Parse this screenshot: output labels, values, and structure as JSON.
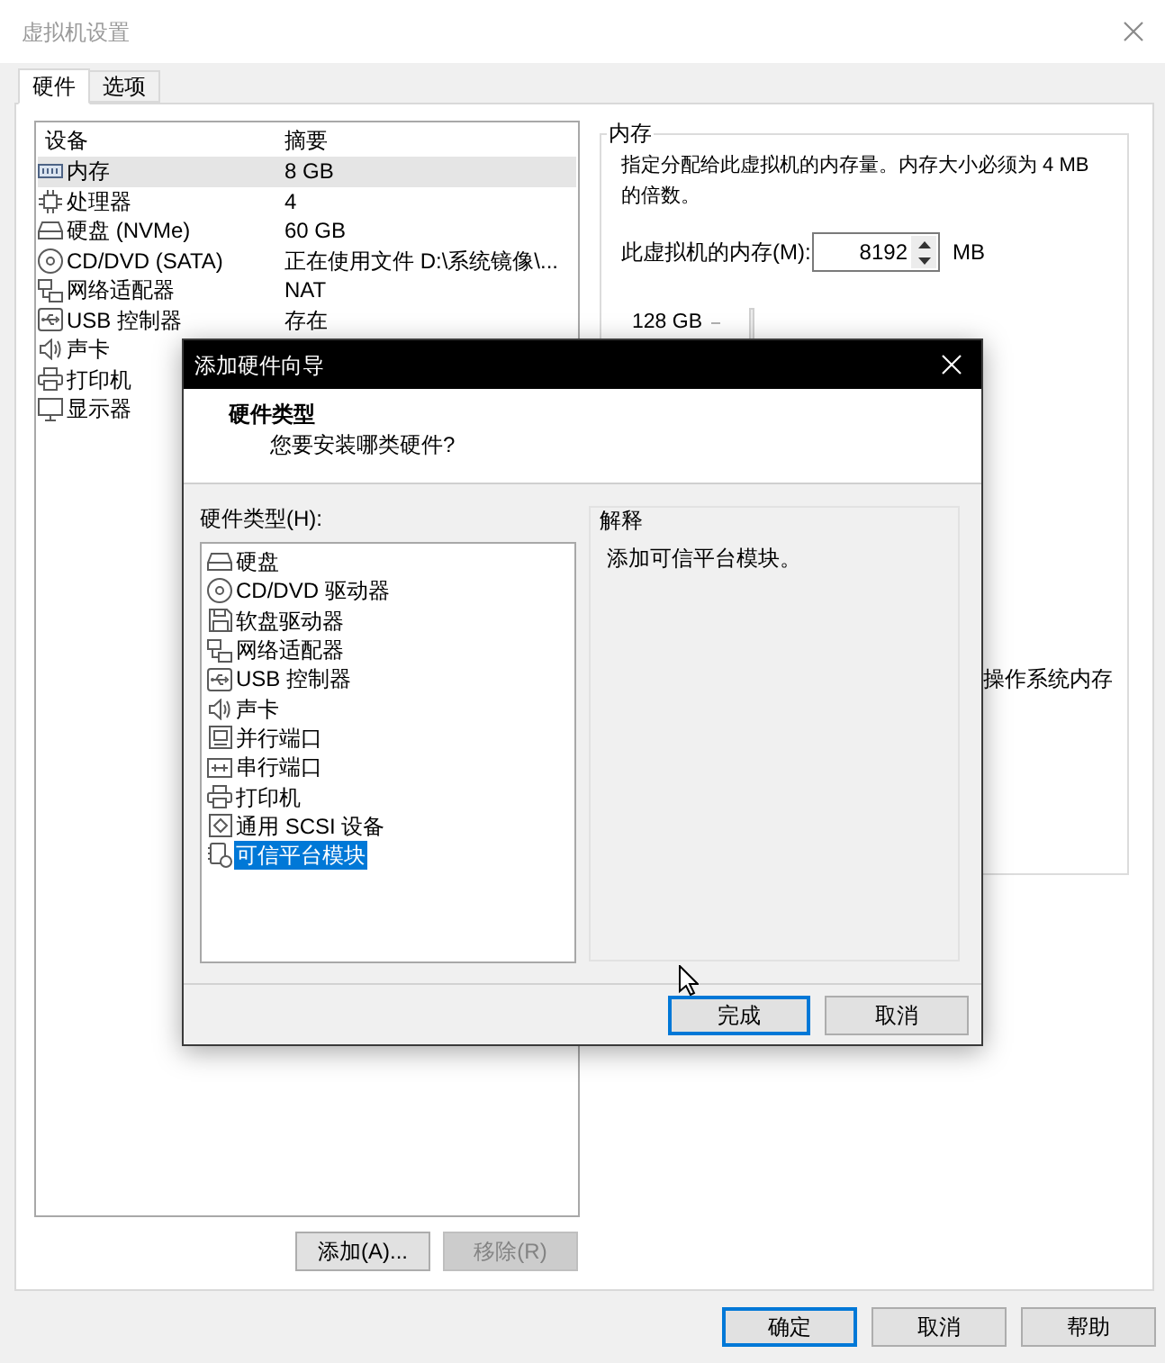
{
  "window": {
    "title": "虚拟机设置"
  },
  "tabs": [
    {
      "label": "硬件",
      "selected": true
    },
    {
      "label": "选项",
      "selected": false
    }
  ],
  "device_list": {
    "columns": [
      "设备",
      "摘要"
    ],
    "rows": [
      {
        "kind": "memory",
        "device": "内存",
        "summary": "8 GB",
        "selected": true
      },
      {
        "kind": "cpu",
        "device": "处理器",
        "summary": "4",
        "selected": false
      },
      {
        "kind": "disk",
        "device": "硬盘 (NVMe)",
        "summary": "60 GB",
        "selected": false
      },
      {
        "kind": "cdrom",
        "device": "CD/DVD (SATA)",
        "summary": "正在使用文件 D:\\系统镜像\\...",
        "selected": false
      },
      {
        "kind": "network",
        "device": "网络适配器",
        "summary": "NAT",
        "selected": false
      },
      {
        "kind": "usb",
        "device": "USB 控制器",
        "summary": "存在",
        "selected": false
      },
      {
        "kind": "sound",
        "device": "声卡",
        "selected": false
      },
      {
        "kind": "printer",
        "device": "打印机",
        "selected": false
      },
      {
        "kind": "display",
        "device": "显示器",
        "selected": false
      }
    ]
  },
  "device_buttons": [
    {
      "label": "添加(A)...",
      "disabled": false
    },
    {
      "label": "移除(R)",
      "disabled": true
    }
  ],
  "memory": {
    "title": "内存",
    "description": "指定分配给此虚拟机的内存量。内存大小必须为 4 MB 的倍数。",
    "field_label": "此虚拟机的内存(M):",
    "value": "8192",
    "unit": "MB",
    "scale_label": "128 GB",
    "note": "操作系统内存"
  },
  "dialog": {
    "title": "添加硬件向导",
    "heading": "硬件类型",
    "subheading": "您要安装哪类硬件?",
    "list_label": "硬件类型(H):",
    "hardware_types": [
      {
        "kind": "disk",
        "label": "硬盘",
        "selected": false
      },
      {
        "kind": "cdrom",
        "label": "CD/DVD 驱动器",
        "selected": false
      },
      {
        "kind": "floppy",
        "label": "软盘驱动器",
        "selected": false
      },
      {
        "kind": "network",
        "label": "网络适配器",
        "selected": false
      },
      {
        "kind": "usb",
        "label": "USB 控制器",
        "selected": false
      },
      {
        "kind": "sound",
        "label": "声卡",
        "selected": false
      },
      {
        "kind": "parallel",
        "label": "并行端口",
        "selected": false
      },
      {
        "kind": "serial",
        "label": "串行端口",
        "selected": false
      },
      {
        "kind": "printer",
        "label": "打印机",
        "selected": false
      },
      {
        "kind": "scsi",
        "label": "通用 SCSI 设备",
        "selected": false
      },
      {
        "kind": "tpm",
        "label": "可信平台模块",
        "selected": true
      }
    ],
    "explanation_title": "解释",
    "explanation": "添加可信平台模块。",
    "buttons": [
      {
        "label": "完成",
        "default": true
      },
      {
        "label": "取消",
        "default": false
      }
    ]
  },
  "buttons": [
    {
      "label": "确定",
      "default": true
    },
    {
      "label": "取消",
      "default": false
    },
    {
      "label": "帮助",
      "default": false
    }
  ]
}
